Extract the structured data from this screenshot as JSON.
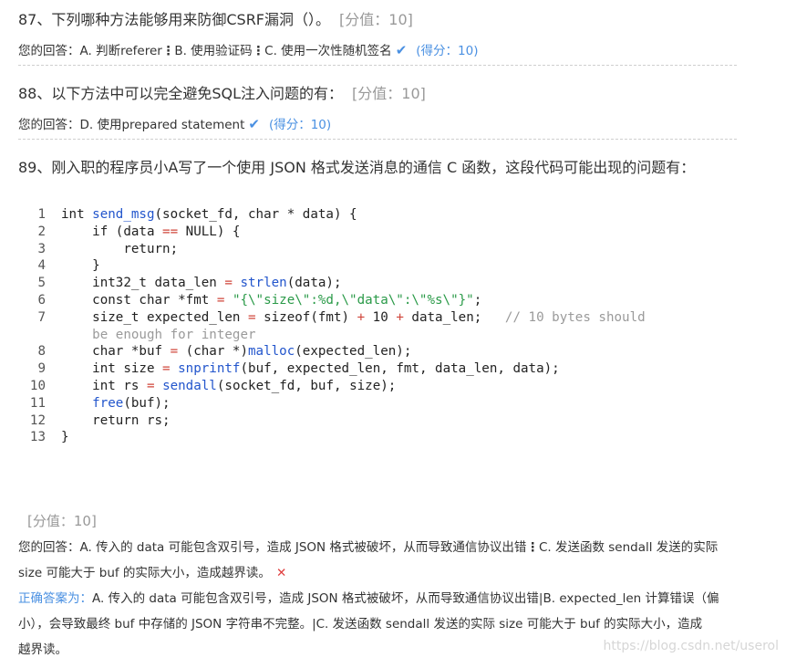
{
  "q87": {
    "title": "87、下列哪种方法能够用来防御CSRF漏洞（）。",
    "score": "[分值：10]",
    "answer_label": "您的回答：",
    "answer_a": "A. 判断referer",
    "answer_b": "B. 使用验证码",
    "answer_c": "C. 使用一次性随机签名",
    "got": "(得分：10)"
  },
  "q88": {
    "title": "88、以下方法中可以完全避免SQL注入问题的有：",
    "score": "[分值：10]",
    "answer_label": "您的回答：",
    "answer": "D. 使用prepared statement",
    "got": "(得分：10)"
  },
  "q89": {
    "title": "89、刚入职的程序员小A写了一个使用 JSON 格式发送消息的通信 C 函数，这段代码可能出现的问题有：",
    "score": "[分值：10]",
    "answer_label": "您的回答：",
    "answer_a": "A. 传入的 data 可能包含双引号，造成 JSON 格式被破坏，从而导致通信协议出错",
    "answer_c1": "C. 发送函数 sendall 发送的实际",
    "answer_c2": "size 可能大于 buf 的实际大小，造成越界读。",
    "correct_label": "正确答案为：",
    "correct_1": "A. 传入的 data 可能包含双引号，造成 JSON 格式被破坏，从而导致通信协议出错|B. expected_len 计算错误（偏",
    "correct_2": "小），会导致最终 buf 中存储的 JSON 字符串不完整。|C. 发送函数 sendall 发送的实际 size 可能大于 buf 的实际大小，造成",
    "correct_3": "越界读。"
  },
  "code": {
    "line_numbers": [
      "1",
      "2",
      "3",
      "4",
      "5",
      "6",
      "7",
      "8",
      "9",
      "10",
      "11",
      "12",
      "13"
    ],
    "l1a": "int ",
    "l1b": "send_msg",
    "l1c": "(socket_fd, char * data) {",
    "l2a": "    if (data ",
    "l2b": "==",
    "l2c": " NULL) {",
    "l3": "        return;",
    "l4": "    }",
    "l5a": "    int32_t data_len ",
    "l5b": "=",
    "l5c": " ",
    "l5d": "strlen",
    "l5e": "(data);",
    "l6a": "    const char *fmt ",
    "l6b": "=",
    "l6c": " ",
    "l6d": "\"{\\\"size\\\":%d,\\\"data\\\":\\\"%s\\\"}\"",
    "l6e": ";",
    "l7a": "    size_t expected_len ",
    "l7b": "=",
    "l7c": " sizeof(fmt) ",
    "l7d": "+",
    "l7e": " 10 ",
    "l7f": "+",
    "l7g": " data_len;   ",
    "l7h": "// 10 bytes should",
    "l7wrap": "    be enough for integer",
    "l8a": "    char *buf ",
    "l8b": "=",
    "l8c": " (char *)",
    "l8d": "malloc",
    "l8e": "(expected_len);",
    "l9a": "    int size ",
    "l9b": "=",
    "l9c": " ",
    "l9d": "snprintf",
    "l9e": "(buf, expected_len, fmt, data_len, data);",
    "l10a": "    int rs ",
    "l10b": "=",
    "l10c": " ",
    "l10d": "sendall",
    "l10e": "(socket_fd, buf, size);",
    "l11a": "    ",
    "l11b": "free",
    "l11c": "(buf);",
    "l12": "    return rs;",
    "l13": "}"
  },
  "watermark": "https://blog.csdn.net/userol"
}
